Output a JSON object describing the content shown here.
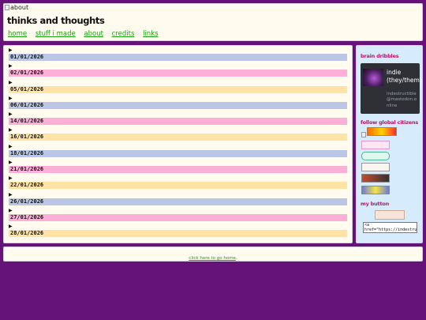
{
  "header": {
    "image_alt": "about",
    "title": "thinks and thoughts",
    "nav": [
      "home",
      "stuff i made",
      "about",
      "credits",
      "links"
    ]
  },
  "colors": {
    "background": "#651279",
    "panel": "#fffbee",
    "sidebar": "#d6ebfb",
    "link": "#1f9e1a",
    "bar_blue": "#bac6e3",
    "bar_pink": "#fcafd7",
    "bar_yellow": "#fee3a5",
    "sidebar_heading": "#b0196b"
  },
  "entries": [
    {
      "date": "01/01/2026",
      "color": "#bac6e3"
    },
    {
      "date": "02/01/2026",
      "color": "#fcafd7"
    },
    {
      "date": "05/01/2026",
      "color": "#fee3a5"
    },
    {
      "date": "06/01/2026",
      "color": "#bac6e3"
    },
    {
      "date": "14/01/2026",
      "color": "#fcafd7"
    },
    {
      "date": "16/01/2026",
      "color": "#fee3a5"
    },
    {
      "date": "18/01/2026",
      "color": "#bac6e3"
    },
    {
      "date": "21/01/2026",
      "color": "#fcafd7"
    },
    {
      "date": "22/01/2026",
      "color": "#fee3a5"
    },
    {
      "date": "26/01/2026",
      "color": "#bac6e3"
    },
    {
      "date": "27/01/2026",
      "color": "#fcafd7"
    },
    {
      "date": "28/01/2026",
      "color": "#fee3a5"
    }
  ],
  "sidebar": {
    "brain_title": "brain dribbles",
    "profile_name": "indie (they/them)",
    "profile_handle": "indestructible@mastodon.online",
    "follow_title": "follow global citizens",
    "button_title": "my button",
    "button_code": "<a href=\"https://indestruc"
  },
  "footer": {
    "link_text": "click here to go home",
    "suffix": "."
  }
}
